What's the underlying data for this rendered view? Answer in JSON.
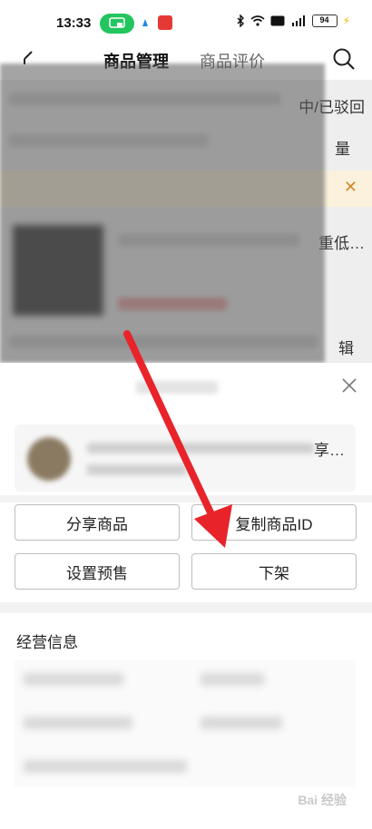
{
  "status_bar": {
    "time": "13:33",
    "battery": "94",
    "icons": [
      "bluetooth-icon",
      "wifi-icon",
      "hd-icon",
      "signal-icon",
      "battery-icon"
    ]
  },
  "header": {
    "tabs": [
      {
        "label": "商品管理",
        "active": true
      },
      {
        "label": "商品评价",
        "active": false
      }
    ]
  },
  "background": {
    "side_text_1": "中/已驳回",
    "side_text_2": "量",
    "side_text_3": "重低…",
    "side_text_4": "辑"
  },
  "sheet": {
    "product_side_text": "享…",
    "buttons": {
      "share": "分享商品",
      "copy_id": "复制商品ID",
      "presale": "设置预售",
      "delist": "下架"
    },
    "info_section_title": "经营信息"
  },
  "colors": {
    "accent_green": "#22c55e",
    "arrow_red": "#e8232a",
    "battery_bolt": "#f5b800"
  },
  "watermark": "Bai 经验"
}
